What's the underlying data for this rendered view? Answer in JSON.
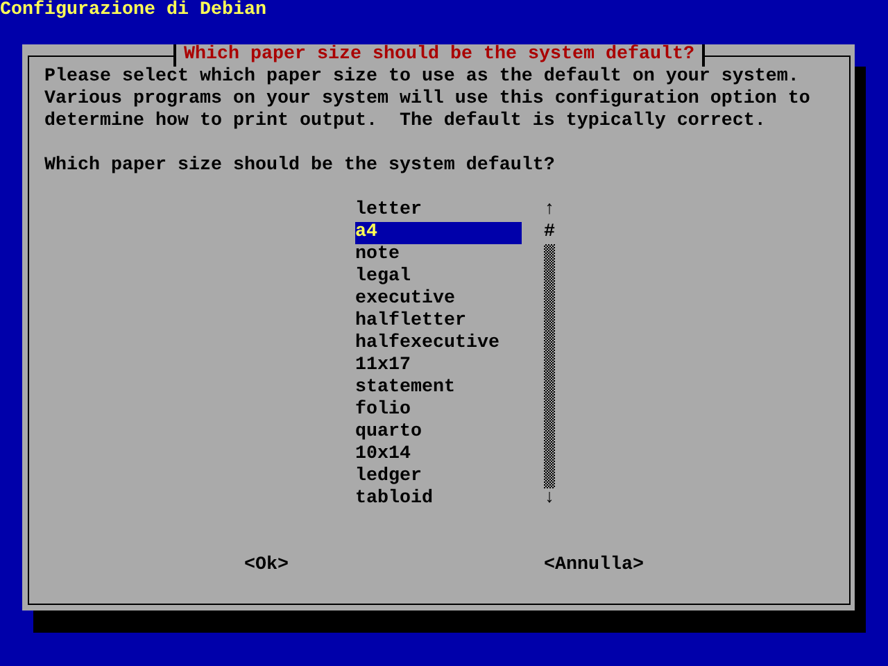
{
  "screen_title": "Configurazione di Debian",
  "dialog": {
    "title": "Which paper size should be the system default?",
    "description": "Please select which paper size to use as the default on your system.\nVarious programs on your system will use this configuration option to\ndetermine how to print output.  The default is typically correct.",
    "question": "Which paper size should be the system default?",
    "options": [
      {
        "label": "letter",
        "selected": false
      },
      {
        "label": "a4",
        "selected": true
      },
      {
        "label": "note",
        "selected": false
      },
      {
        "label": "legal",
        "selected": false
      },
      {
        "label": "executive",
        "selected": false
      },
      {
        "label": "halfletter",
        "selected": false
      },
      {
        "label": "halfexecutive",
        "selected": false
      },
      {
        "label": "11x17",
        "selected": false
      },
      {
        "label": "statement",
        "selected": false
      },
      {
        "label": "folio",
        "selected": false
      },
      {
        "label": "quarto",
        "selected": false
      },
      {
        "label": "10x14",
        "selected": false
      },
      {
        "label": "ledger",
        "selected": false
      },
      {
        "label": "tabloid",
        "selected": false
      }
    ],
    "scrollbar": {
      "up": "↑",
      "thumb": "#",
      "down": "↓"
    },
    "buttons": [
      {
        "label": "<Ok>",
        "selected": false
      },
      {
        "label": "<Annulla>",
        "selected": false
      }
    ]
  }
}
